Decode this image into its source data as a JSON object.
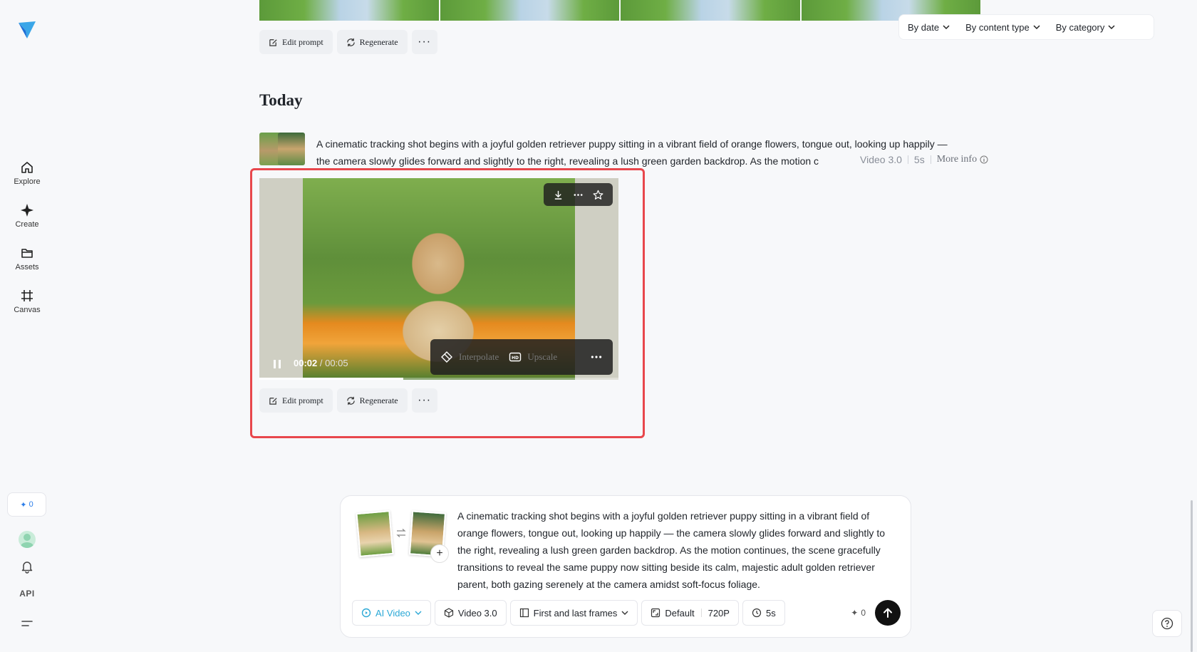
{
  "sidebar": {
    "items": [
      {
        "label": "Explore",
        "icon": "home-icon"
      },
      {
        "label": "Create",
        "icon": "sparkle-icon"
      },
      {
        "label": "Assets",
        "icon": "folder-icon"
      },
      {
        "label": "Canvas",
        "icon": "crop-icon"
      }
    ],
    "credits": "0",
    "api_label": "API"
  },
  "filters": {
    "by_date": "By date",
    "by_content_type": "By content type",
    "by_category": "By category"
  },
  "previous_actions": {
    "edit_prompt": "Edit prompt",
    "regenerate": "Regenerate",
    "more": "···"
  },
  "section": {
    "title": "Today"
  },
  "generation": {
    "prompt_line1": "A cinematic tracking shot begins with a joyful golden retriever puppy sitting in a vibrant field of orange flowers, tongue out, looking up happily —",
    "prompt_line2": "the camera slowly glides forward and slightly to the right, revealing a lush green garden backdrop. As the motion c",
    "model": "Video 3.0",
    "duration": "5s",
    "more_info": "More info",
    "video": {
      "current_time": "00:02",
      "total_time": "/ 00:05",
      "progress": 0.4,
      "interpolate": "Interpolate",
      "upscale": "Upscale"
    },
    "actions": {
      "edit_prompt": "Edit prompt",
      "regenerate": "Regenerate",
      "more": "···"
    }
  },
  "composer": {
    "prompt": "A cinematic tracking shot begins with a joyful golden retriever puppy sitting in a vibrant field of orange flowers, tongue out, looking up happily — the camera slowly glides forward and slightly to the right, revealing a lush green garden backdrop. As the motion continues, the scene gracefully transitions to reveal the same puppy now sitting beside its calm, majestic adult golden retriever parent, both gazing serenely at the camera amidst soft-focus foliage.",
    "mode": "AI Video",
    "model": "Video 3.0",
    "frames": "First and last frames",
    "ratio": "Default",
    "resolution": "720P",
    "duration": "5s",
    "credits": "0"
  },
  "colors": {
    "highlight": "#e8474c",
    "accent": "#2ba8d6",
    "credit_blue": "#2b7de9"
  }
}
